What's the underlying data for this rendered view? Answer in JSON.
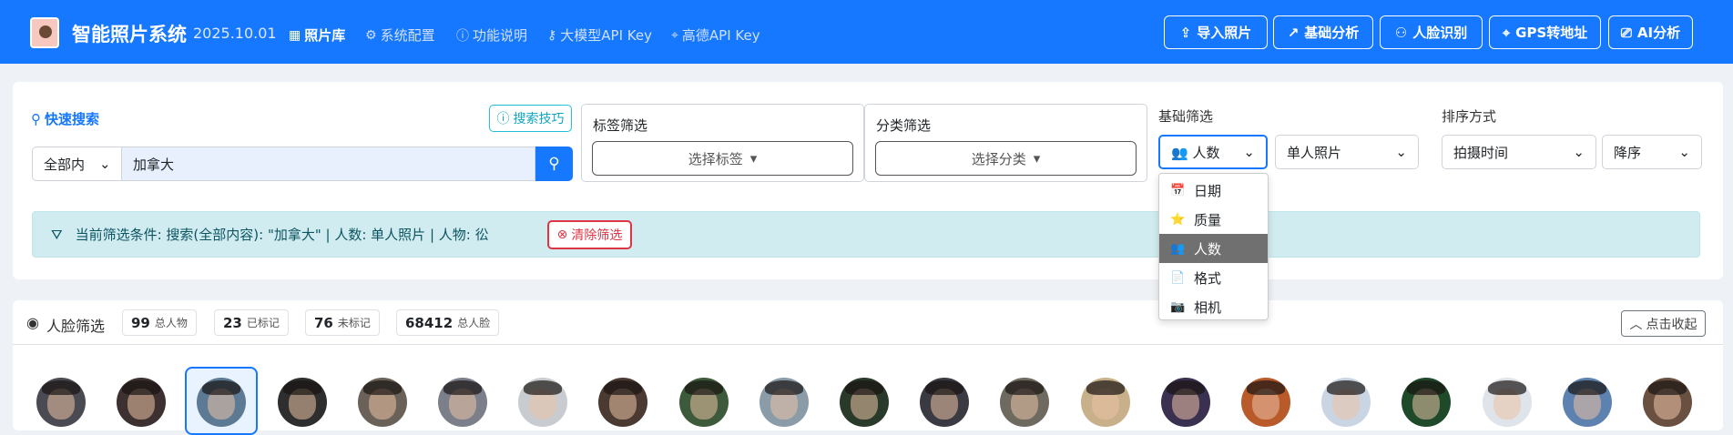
{
  "header": {
    "brand": "智能照片系统",
    "version": "2025.10.01",
    "nav": [
      {
        "label": "照片库",
        "icon": "grid-icon"
      },
      {
        "label": "系统配置",
        "icon": "gear-icon"
      },
      {
        "label": "功能说明",
        "icon": "info-icon"
      },
      {
        "label": "大模型API Key",
        "icon": "key-icon"
      },
      {
        "label": "高德API Key",
        "icon": "pin-icon"
      }
    ],
    "actions": [
      {
        "label": "导入照片",
        "icon": "upload-icon"
      },
      {
        "label": "基础分析",
        "icon": "chart-icon"
      },
      {
        "label": "人脸识别",
        "icon": "people-icon"
      },
      {
        "label": "GPS转地址",
        "icon": "pin-icon"
      },
      {
        "label": "AI分析",
        "icon": "robot-icon"
      }
    ]
  },
  "search": {
    "title": "快速搜索",
    "tips_label": "搜索技巧",
    "scope": "全部内",
    "query": "加拿大"
  },
  "tag_filter": {
    "title": "标签筛选",
    "placeholder": "选择标签"
  },
  "category_filter": {
    "title": "分类筛选",
    "placeholder": "选择分类"
  },
  "basic_filter": {
    "title": "基础筛选",
    "selected": "人数",
    "value": "单人照片",
    "options": [
      {
        "label": "日期",
        "icon": "calendar-icon",
        "glyph": "📅"
      },
      {
        "label": "质量",
        "icon": "star-icon",
        "glyph": "⭐"
      },
      {
        "label": "人数",
        "icon": "people-icon",
        "glyph": "👥"
      },
      {
        "label": "格式",
        "icon": "document-icon",
        "glyph": "📄"
      },
      {
        "label": "相机",
        "icon": "camera-icon",
        "glyph": "📷"
      }
    ]
  },
  "sort": {
    "title": "排序方式",
    "field": "拍摄时间",
    "order": "降序"
  },
  "current_filter": {
    "text": "当前筛选条件: 搜索(全部内容): \"加拿大\" | 人数: 单人照片 | 人物: 彸",
    "clear_label": "清除筛选"
  },
  "faces": {
    "title": "人脸筛选",
    "stats": [
      {
        "value": "99",
        "label": "总人物"
      },
      {
        "value": "23",
        "label": "已标记"
      },
      {
        "value": "76",
        "label": "未标记"
      },
      {
        "value": "68412",
        "label": "总人脸"
      }
    ],
    "collapse_label": "点击收起",
    "count": 21
  },
  "colors": {
    "primary": "#1677ff",
    "danger": "#dc3545",
    "info_bg": "#d1ecf1"
  }
}
